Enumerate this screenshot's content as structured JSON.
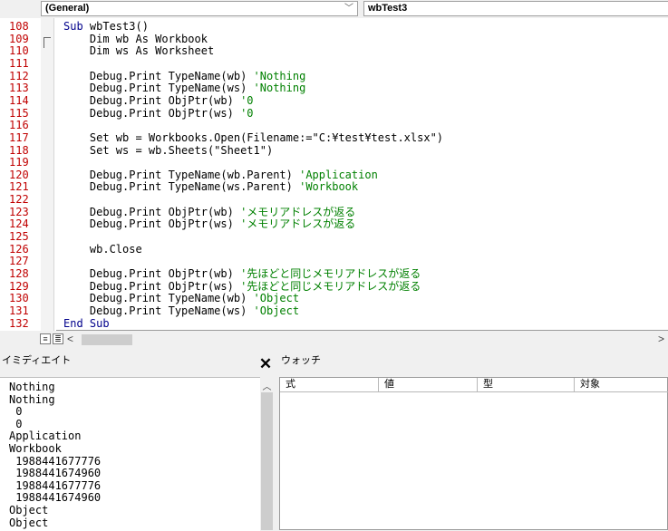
{
  "toolbar": {
    "object_combo": "(General)",
    "procedure_combo": "wbTest3"
  },
  "code": {
    "line_numbers": [
      "108",
      "109",
      "110",
      "111",
      "112",
      "113",
      "114",
      "115",
      "116",
      "117",
      "118",
      "119",
      "120",
      "121",
      "122",
      "123",
      "124",
      "125",
      "126",
      "127",
      "128",
      "129",
      "130",
      "131",
      "132"
    ],
    "lines": [
      {
        "kw": "Sub ",
        "code": "wbTest3()",
        "cm": ""
      },
      {
        "kw": "",
        "code": "    Dim wb As Workbook",
        "cm": ""
      },
      {
        "kw": "",
        "code": "    Dim ws As Worksheet",
        "cm": ""
      },
      {
        "kw": "",
        "code": "",
        "cm": ""
      },
      {
        "kw": "",
        "code": "    Debug.Print TypeName(wb) ",
        "cm": "'Nothing"
      },
      {
        "kw": "",
        "code": "    Debug.Print TypeName(ws) ",
        "cm": "'Nothing"
      },
      {
        "kw": "",
        "code": "    Debug.Print ObjPtr(wb) ",
        "cm": "'0"
      },
      {
        "kw": "",
        "code": "    Debug.Print ObjPtr(ws) ",
        "cm": "'0"
      },
      {
        "kw": "",
        "code": "",
        "cm": ""
      },
      {
        "kw": "",
        "code": "    Set wb = Workbooks.Open(Filename:=\"C:¥test¥test.xlsx\")",
        "cm": ""
      },
      {
        "kw": "",
        "code": "    Set ws = wb.Sheets(\"Sheet1\")",
        "cm": ""
      },
      {
        "kw": "",
        "code": "",
        "cm": ""
      },
      {
        "kw": "",
        "code": "    Debug.Print TypeName(wb.Parent) ",
        "cm": "'Application"
      },
      {
        "kw": "",
        "code": "    Debug.Print TypeName(ws.Parent) ",
        "cm": "'Workbook"
      },
      {
        "kw": "",
        "code": "",
        "cm": ""
      },
      {
        "kw": "",
        "code": "    Debug.Print ObjPtr(wb) ",
        "cm": "'メモリアドレスが返る"
      },
      {
        "kw": "",
        "code": "    Debug.Print ObjPtr(ws) ",
        "cm": "'メモリアドレスが返る"
      },
      {
        "kw": "",
        "code": "",
        "cm": ""
      },
      {
        "kw": "",
        "code": "    wb.Close",
        "cm": ""
      },
      {
        "kw": "",
        "code": "",
        "cm": ""
      },
      {
        "kw": "",
        "code": "    Debug.Print ObjPtr(wb) ",
        "cm": "'先ほどと同じメモリアドレスが返る"
      },
      {
        "kw": "",
        "code": "    Debug.Print ObjPtr(ws) ",
        "cm": "'先ほどと同じメモリアドレスが返る"
      },
      {
        "kw": "",
        "code": "    Debug.Print TypeName(wb) ",
        "cm": "'Object"
      },
      {
        "kw": "",
        "code": "    Debug.Print TypeName(ws) ",
        "cm": "'Object"
      },
      {
        "kw": "End Sub",
        "code": "",
        "cm": ""
      }
    ]
  },
  "immediate": {
    "title": "イミディエイト",
    "close_glyph": "✕",
    "lines": [
      "Nothing",
      "Nothing",
      " 0",
      " 0",
      "Application",
      "Workbook",
      " 1988441677776",
      " 1988441674960",
      " 1988441677776",
      " 1988441674960",
      "Object",
      "Object"
    ]
  },
  "watch": {
    "title": "ウォッチ",
    "columns": [
      "式",
      "値",
      "型",
      "対象"
    ]
  },
  "colors": {
    "keyword": "#00008b",
    "comment": "#008000",
    "line_number": "#c00000"
  }
}
